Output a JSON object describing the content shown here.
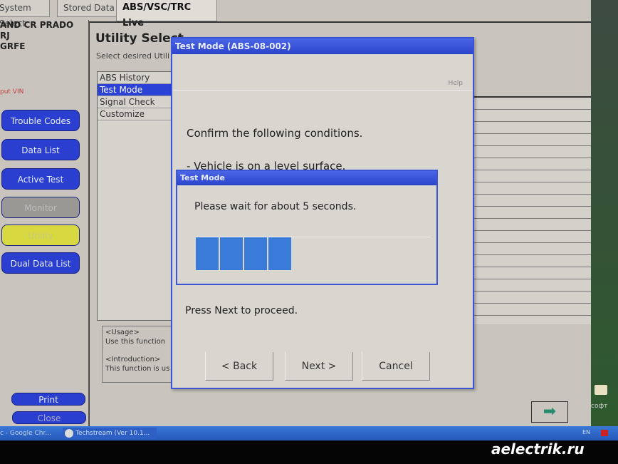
{
  "tabs": [
    {
      "label": "System Select"
    },
    {
      "label": "Stored Data"
    },
    {
      "label": "ABS/VSC/TRC Live"
    }
  ],
  "vehicle": {
    "line1": "AND CR PRADO",
    "line2": "RJ",
    "line3": "GRFE",
    "vin_link": "put VIN"
  },
  "sidebar": {
    "buttons": [
      {
        "label": "Trouble Codes"
      },
      {
        "label": "Data List"
      },
      {
        "label": "Active Test"
      },
      {
        "label": "Monitor"
      },
      {
        "label": "Utility"
      },
      {
        "label": "Dual Data List"
      }
    ],
    "print": "Print",
    "close": "Close"
  },
  "main": {
    "title": "Utility Select",
    "subtitle": "Select desired Utili",
    "utilities": [
      {
        "label": "ABS History"
      },
      {
        "label": "Test Mode",
        "selected": true
      },
      {
        "label": "Signal Check"
      },
      {
        "label": "Customize"
      }
    ],
    "usage_heading": "<Usage>",
    "usage_text": "Use this function",
    "intro_heading": "<Introduction>",
    "intro_text": "This function is us"
  },
  "dialog": {
    "title": "Test Mode (ABS-08-002)",
    "help": "Help",
    "confirm": "Confirm the following conditions.",
    "condition1": "- Vehicle is on a level surface.",
    "proceed": "Press Next to proceed.",
    "back": "< Back",
    "next": "Next >",
    "cancel": "Cancel"
  },
  "wait_dialog": {
    "title": "Test Mode",
    "message": "Please wait for about 5 seconds.",
    "progress": "4/12"
  },
  "desktop": {
    "folder_label": "софт"
  },
  "taskbar": {
    "item1": "c - Google Chr...",
    "item2": "Techstream (Ver 10.1...",
    "lang": "EN"
  },
  "watermark": "aelectrik.ru",
  "colors": {
    "accent": "#2b44cc",
    "button_blue": "#2a3fd0",
    "utility_yellow": "#d8d840"
  }
}
